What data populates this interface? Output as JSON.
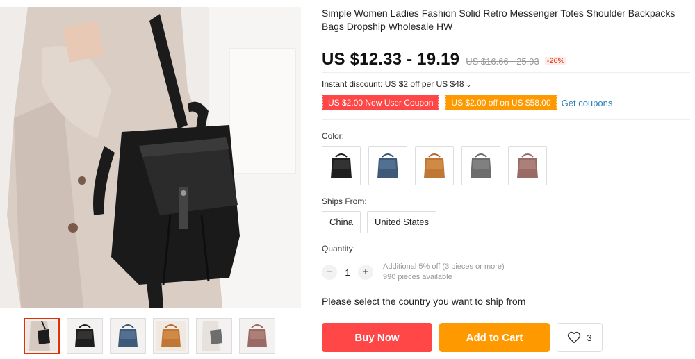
{
  "product": {
    "title": "Simple Women Ladies Fashion Solid Retro Messenger Totes Shoulder Backpacks Bags Dropship Wholesale HW",
    "price": "US $12.33 - 19.19",
    "original_price": "US $16.66 - 25.93",
    "discount": "-26%"
  },
  "promotions": {
    "instant_discount": "Instant discount: US $2 off per US $48",
    "coupons": [
      "US $2.00 New User Coupon",
      "US $2.00 off on US $58.00"
    ],
    "get_coupons_label": "Get coupons"
  },
  "color": {
    "label": "Color:",
    "options": [
      {
        "icon": "black-backpack-icon",
        "hex": "#1e1e1e"
      },
      {
        "icon": "blue-backpack-icon",
        "hex": "#3f5a78"
      },
      {
        "icon": "brown-backpack-icon",
        "hex": "#b5682d"
      },
      {
        "icon": "gray-backpack-icon",
        "hex": "#6d6d6d"
      },
      {
        "icon": "pink-backpack-icon",
        "hex": "#9a6b66"
      }
    ]
  },
  "ships_from": {
    "label": "Ships From:",
    "options": [
      "China",
      "United States"
    ]
  },
  "quantity": {
    "label": "Quantity:",
    "value": "1",
    "minus": "−",
    "plus": "+",
    "note_line1": "Additional 5% off (3 pieces or more)",
    "note_line2": "990 pieces available"
  },
  "shipping_message": "Please select the country you want to ship from",
  "actions": {
    "buy_now": "Buy Now",
    "add_to_cart": "Add to Cart",
    "wishlist_count": "3"
  },
  "gallery": {
    "thumbnails": [
      {
        "icon": "woman-with-backpack-icon"
      },
      {
        "icon": "black-backpack-icon"
      },
      {
        "icon": "blue-backpack-icon"
      },
      {
        "icon": "brown-backpack-icon"
      },
      {
        "icon": "gray-backpack-icon"
      },
      {
        "icon": "pink-backpack-icon"
      }
    ]
  },
  "colors": {
    "price_red": "#ff4747",
    "coupon_orange": "#ff9900",
    "link_blue": "#2a7fb8"
  }
}
